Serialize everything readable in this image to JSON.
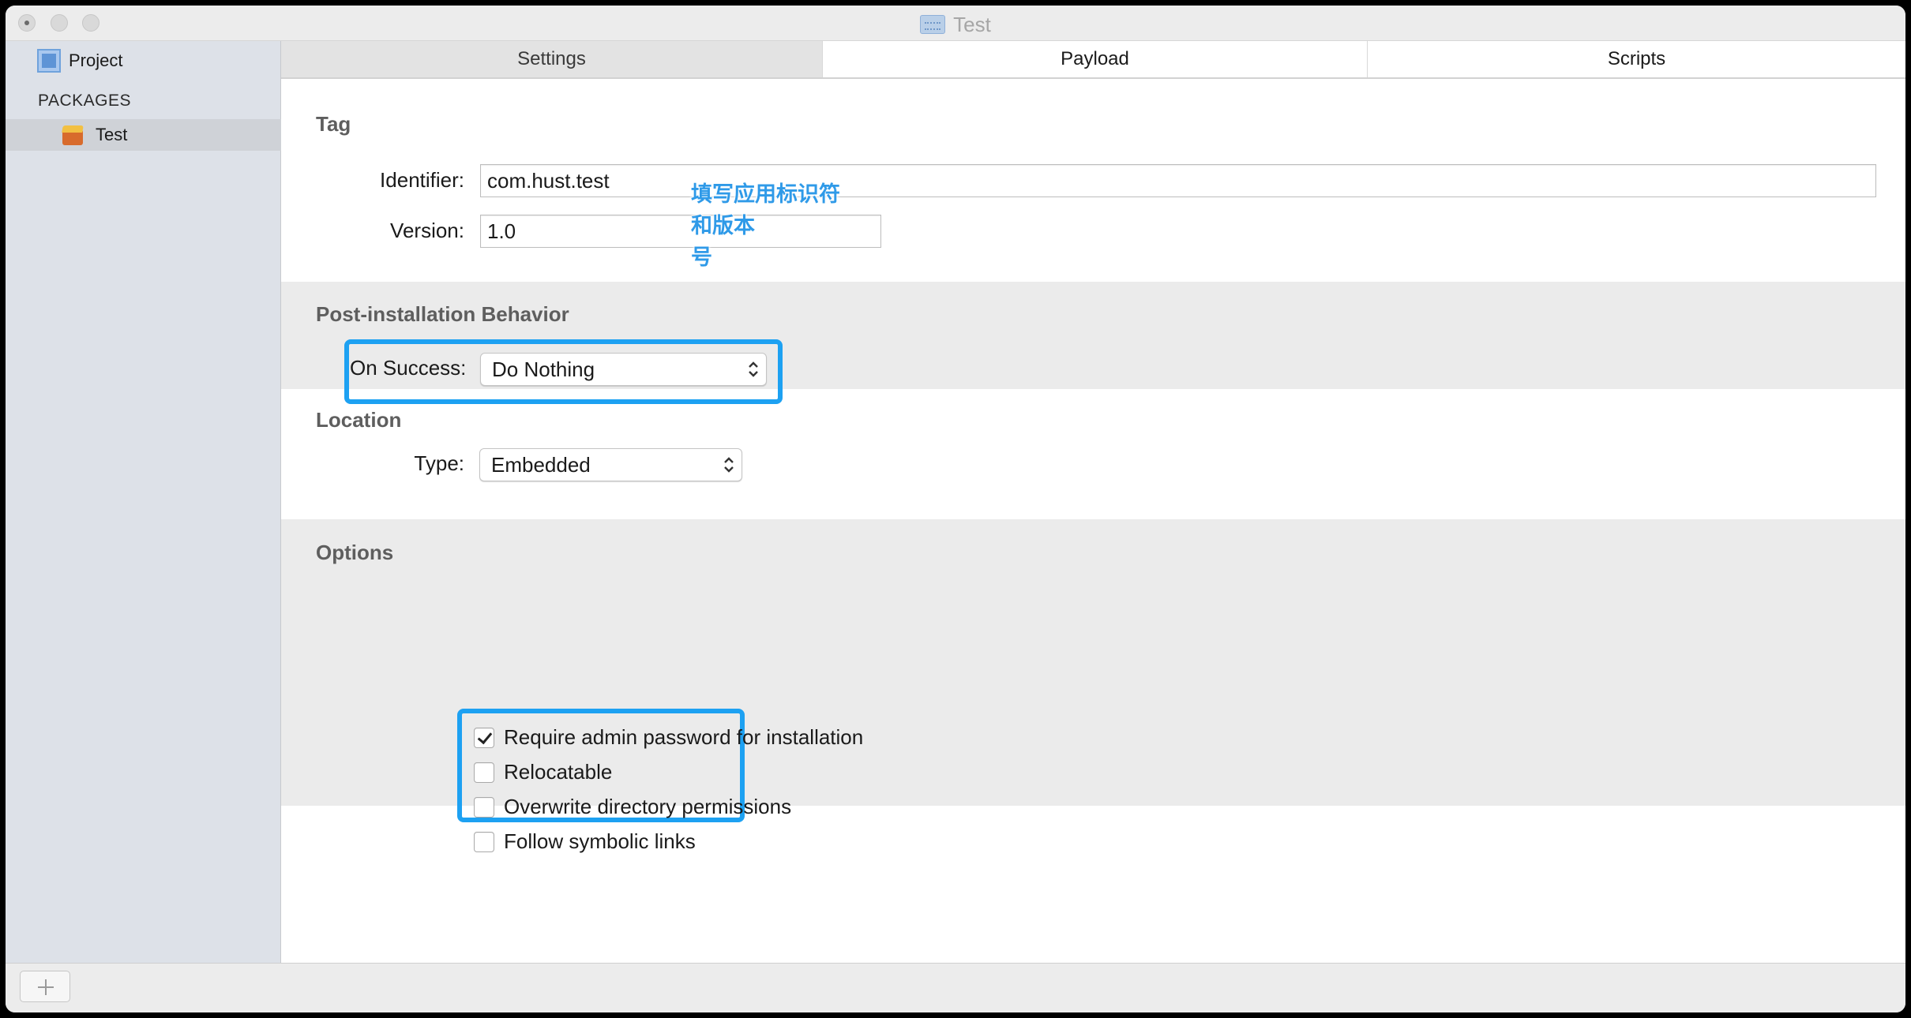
{
  "window": {
    "title": "Test"
  },
  "sidebar": {
    "project_label": "Project",
    "section_label": "PACKAGES",
    "packages": [
      {
        "label": "Test",
        "selected": true
      }
    ]
  },
  "tabs": [
    {
      "label": "Settings",
      "active": true
    },
    {
      "label": "Payload",
      "active": false
    },
    {
      "label": "Scripts",
      "active": false
    }
  ],
  "tag": {
    "title": "Tag",
    "identifier_label": "Identifier:",
    "identifier_value": "com.hust.test",
    "version_label": "Version:",
    "version_value": "1.0"
  },
  "annotation": {
    "line1": "填写应用标识符和版本",
    "line2": "号"
  },
  "post_install": {
    "title": "Post-installation Behavior",
    "on_success_label": "On Success:",
    "on_success_value": "Do Nothing"
  },
  "location": {
    "title": "Location",
    "type_label": "Type:",
    "type_value": "Embedded"
  },
  "options": {
    "title": "Options",
    "items": [
      {
        "label": "Require admin password for installation",
        "checked": true
      },
      {
        "label": "Relocatable",
        "checked": false
      },
      {
        "label": "Overwrite directory permissions",
        "checked": false
      },
      {
        "label": "Follow symbolic links",
        "checked": false
      }
    ]
  },
  "colors": {
    "highlight": "#1da1f2",
    "sidebar_bg": "#dde1e8",
    "section_grey": "#ebebeb"
  },
  "icons": {
    "project": "project-icon",
    "package": "package-icon",
    "popup_chevron": "up-down-chevron-icon",
    "add": "plus-icon"
  }
}
